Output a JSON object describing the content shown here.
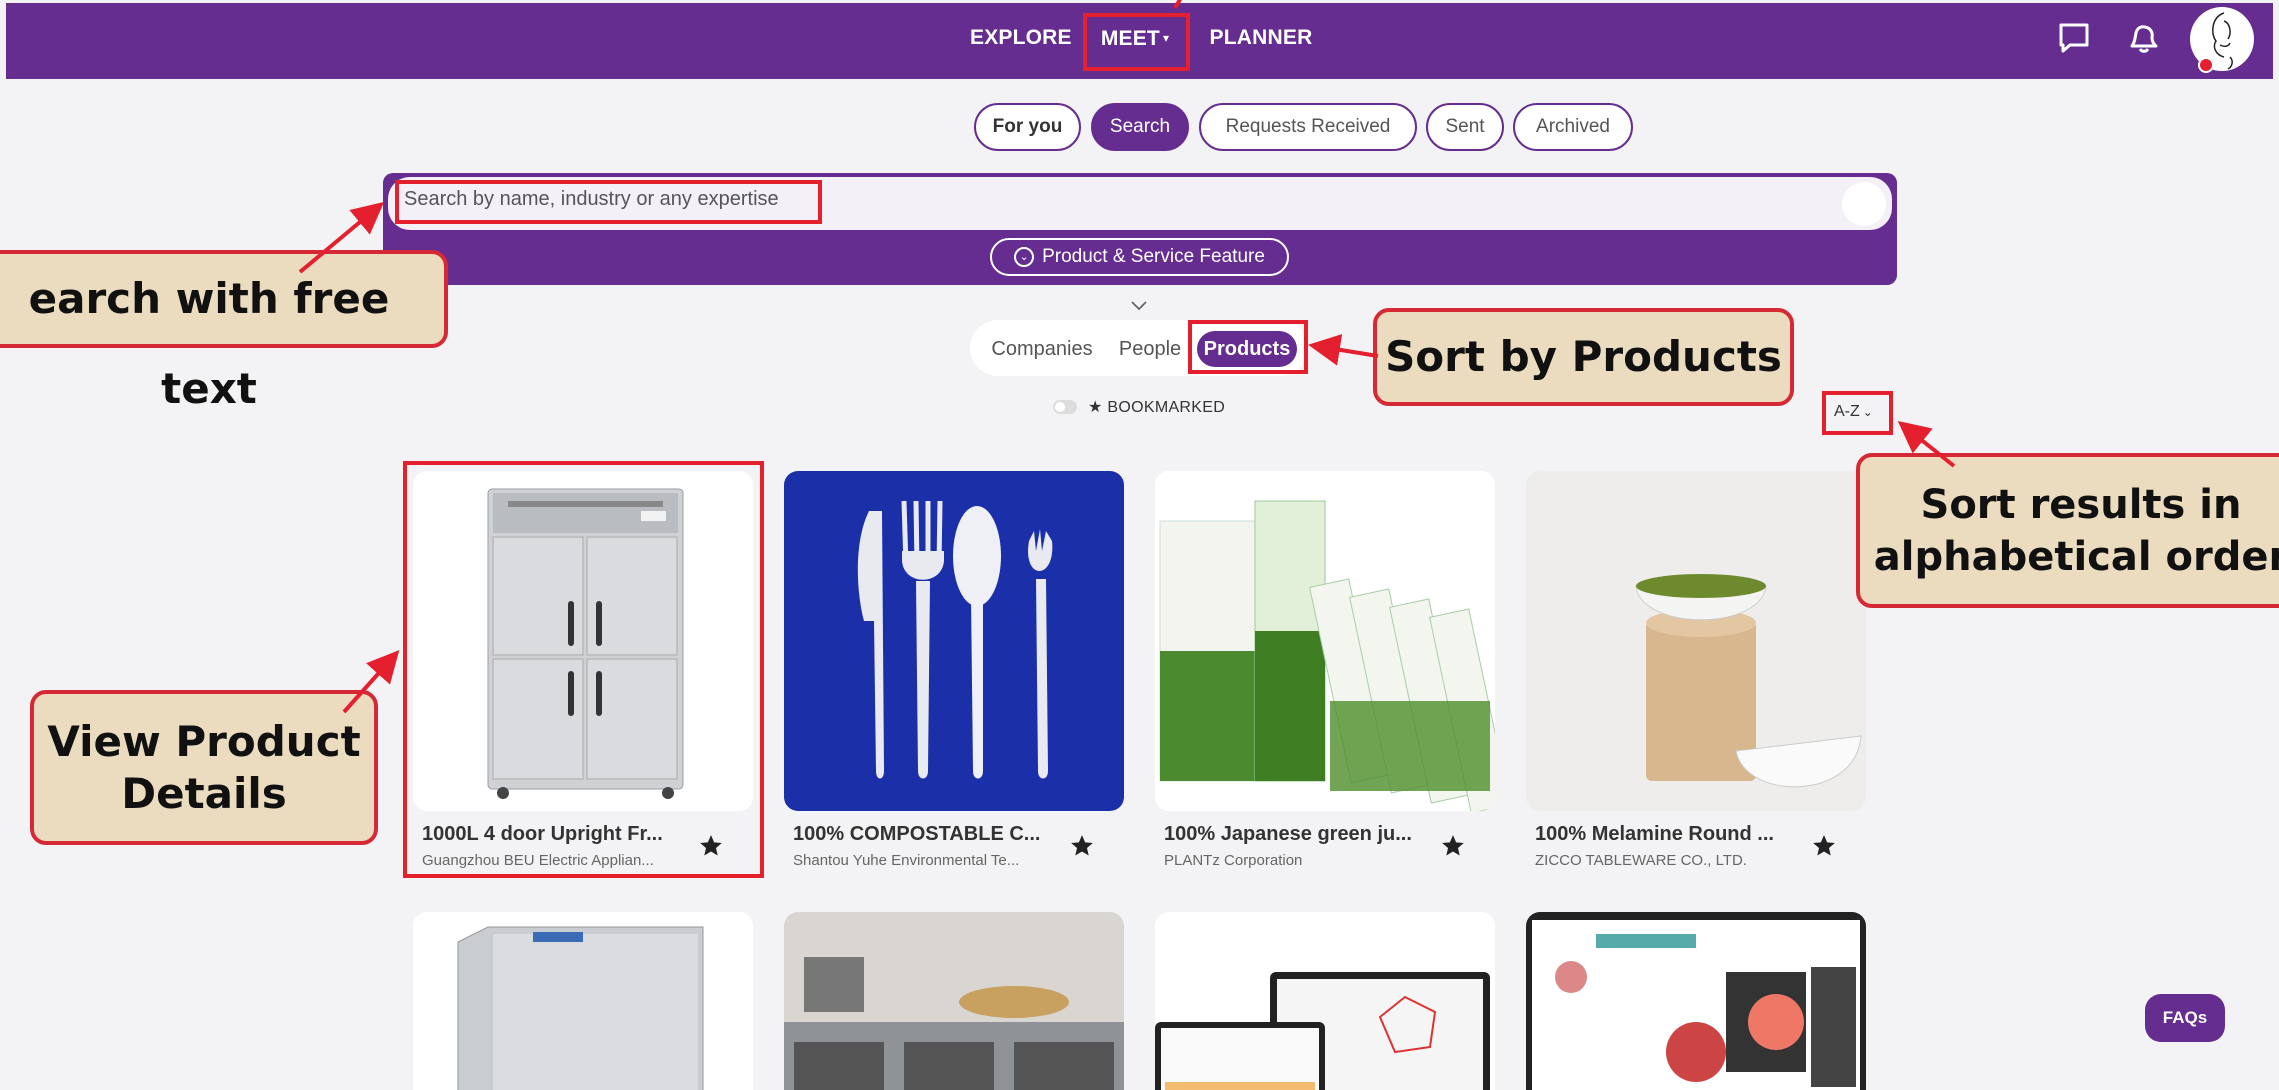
{
  "nav": {
    "explore": "EXPLORE",
    "meet": "MEET",
    "planner": "PLANNER"
  },
  "tabs": [
    "For you",
    "Search",
    "Requests Received",
    "Sent",
    "Archived"
  ],
  "search": {
    "placeholder": "Search by name, industry or any expertise",
    "feature_filter": "Product & Service Feature"
  },
  "view_toggle": [
    "Companies",
    "People",
    "Products"
  ],
  "bookmarked_label": "★ BOOKMARKED",
  "sort_label": "A-Z",
  "products": [
    {
      "title": "1000L 4 door Upright Fr...",
      "company": "Guangzhou BEU Electric Applian..."
    },
    {
      "title": "100% COMPOSTABLE C...",
      "company": "Shantou Yuhe Environmental Te..."
    },
    {
      "title": "100% Japanese green ju...",
      "company": "PLANTz Corporation"
    },
    {
      "title": "100% Melamine Round ...",
      "company": "ZICCO TABLEWARE CO., LTD."
    }
  ],
  "faq_label": "FAQs",
  "annotations": {
    "search_free_text": "earch with free text",
    "sort_products": "Sort by Products",
    "sort_alpha_line1": "Sort results in",
    "sort_alpha_line2": "alphabetical order",
    "view_details_line1": "View Product",
    "view_details_line2": "Details"
  },
  "colors": {
    "brand_purple": "#652d90",
    "annotation_red": "#e4202e",
    "callout_bg": "#ecdcbf"
  }
}
